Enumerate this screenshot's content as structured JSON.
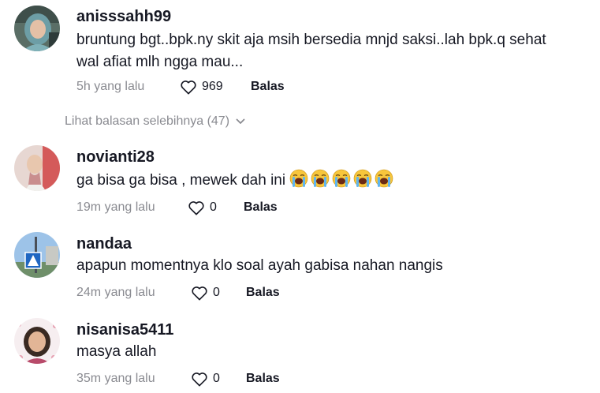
{
  "comments": [
    {
      "username": "anisssahh99",
      "lines": [
        "bruntung bgt..bpk.ny skit aja msih bersedia mnjd saksi..lah bpk.q sehat",
        "wal afiat mlh ngga mau..."
      ],
      "time": "5h yang lalu",
      "likes": "969",
      "reply_label": "Balas"
    },
    {
      "username": "novianti28",
      "lines": [
        "ga bisa ga bisa , mewek dah ini"
      ],
      "emojis": [
        "loudly-crying-face",
        "loudly-crying-face",
        "loudly-crying-face",
        "loudly-crying-face",
        "loudly-crying-face"
      ],
      "time": "19m yang lalu",
      "likes": "0",
      "reply_label": "Balas"
    },
    {
      "username": "nandaa",
      "lines": [
        "apapun momentnya klo soal ayah gabisa nahan nangis"
      ],
      "time": "24m yang lalu",
      "likes": "0",
      "reply_label": "Balas"
    },
    {
      "username": "nisanisa5411",
      "lines": [
        "masya allah"
      ],
      "time": "35m yang lalu",
      "likes": "0",
      "reply_label": "Balas"
    }
  ],
  "view_more_replies": "Lihat balasan selebihnya (47)",
  "icons": {
    "like": "heart-outline-icon",
    "expand": "chevron-down-icon"
  },
  "colors": {
    "text": "#161823",
    "secondary": "#8a8b91",
    "background": "#ffffff"
  }
}
